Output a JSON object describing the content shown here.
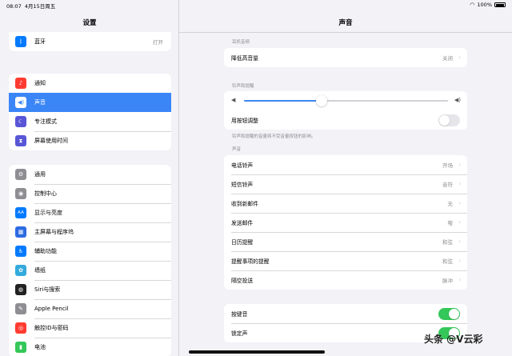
{
  "status": {
    "time": "08:07",
    "date": "4月15日周五",
    "battery": "100%"
  },
  "sidebar": {
    "title": "设置",
    "group1": [
      {
        "label": "蓝牙",
        "value": "打开",
        "icon": "bluetooth-icon",
        "color": "#007aff"
      }
    ],
    "group2": [
      {
        "label": "通知",
        "icon": "bell-icon",
        "color": "#ff3b30"
      },
      {
        "label": "声音",
        "icon": "speaker-icon",
        "color": "#ff2d55",
        "selected": true
      },
      {
        "label": "专注模式",
        "icon": "moon-icon",
        "color": "#5856d6"
      },
      {
        "label": "屏幕使用时间",
        "icon": "hourglass-icon",
        "color": "#5856d6"
      }
    ],
    "group3": [
      {
        "label": "通用",
        "icon": "gear-icon",
        "color": "#8e8e93"
      },
      {
        "label": "控制中心",
        "icon": "switches-icon",
        "color": "#8e8e93"
      },
      {
        "label": "显示与亮度",
        "icon": "aa-icon",
        "color": "#007aff"
      },
      {
        "label": "主屏幕与程序坞",
        "icon": "grid-icon",
        "color": "#2c6be0"
      },
      {
        "label": "辅助功能",
        "icon": "accessibility-icon",
        "color": "#007aff"
      },
      {
        "label": "墙纸",
        "icon": "flower-icon",
        "color": "#34aadc"
      },
      {
        "label": "Siri与搜索",
        "icon": "siri-icon",
        "color": "#222222"
      },
      {
        "label": "Apple Pencil",
        "icon": "pencil-icon",
        "color": "#8e8e93"
      },
      {
        "label": "触控ID与密码",
        "icon": "fingerprint-icon",
        "color": "#ff3b30"
      },
      {
        "label": "电池",
        "icon": "battery-icon",
        "color": "#34c759"
      }
    ]
  },
  "detail": {
    "title": "声音",
    "headphone_section": "耳机音频",
    "headphone_row": {
      "label": "降低高音量",
      "value": "关闭"
    },
    "ringer_section": "铃声和提醒",
    "volume_level": 0.38,
    "button_adjust": {
      "label": "用按钮调整",
      "on": false
    },
    "ringer_note": "铃声和提醒的音量将不受音量按钮的影响。",
    "sounds_section": "声音",
    "sounds": [
      {
        "label": "电话铃声",
        "value": "开场"
      },
      {
        "label": "短信铃声",
        "value": "音符"
      },
      {
        "label": "收到新邮件",
        "value": "无"
      },
      {
        "label": "发送邮件",
        "value": "嗖"
      },
      {
        "label": "日历提醒",
        "value": "和弦"
      },
      {
        "label": "提醒事项的提醒",
        "value": "和弦"
      },
      {
        "label": "隔空投送",
        "value": "脉冲"
      }
    ],
    "toggles": [
      {
        "label": "按键音",
        "on": true
      },
      {
        "label": "锁定声",
        "on": true
      }
    ]
  },
  "watermark": "头条 @V云彩"
}
